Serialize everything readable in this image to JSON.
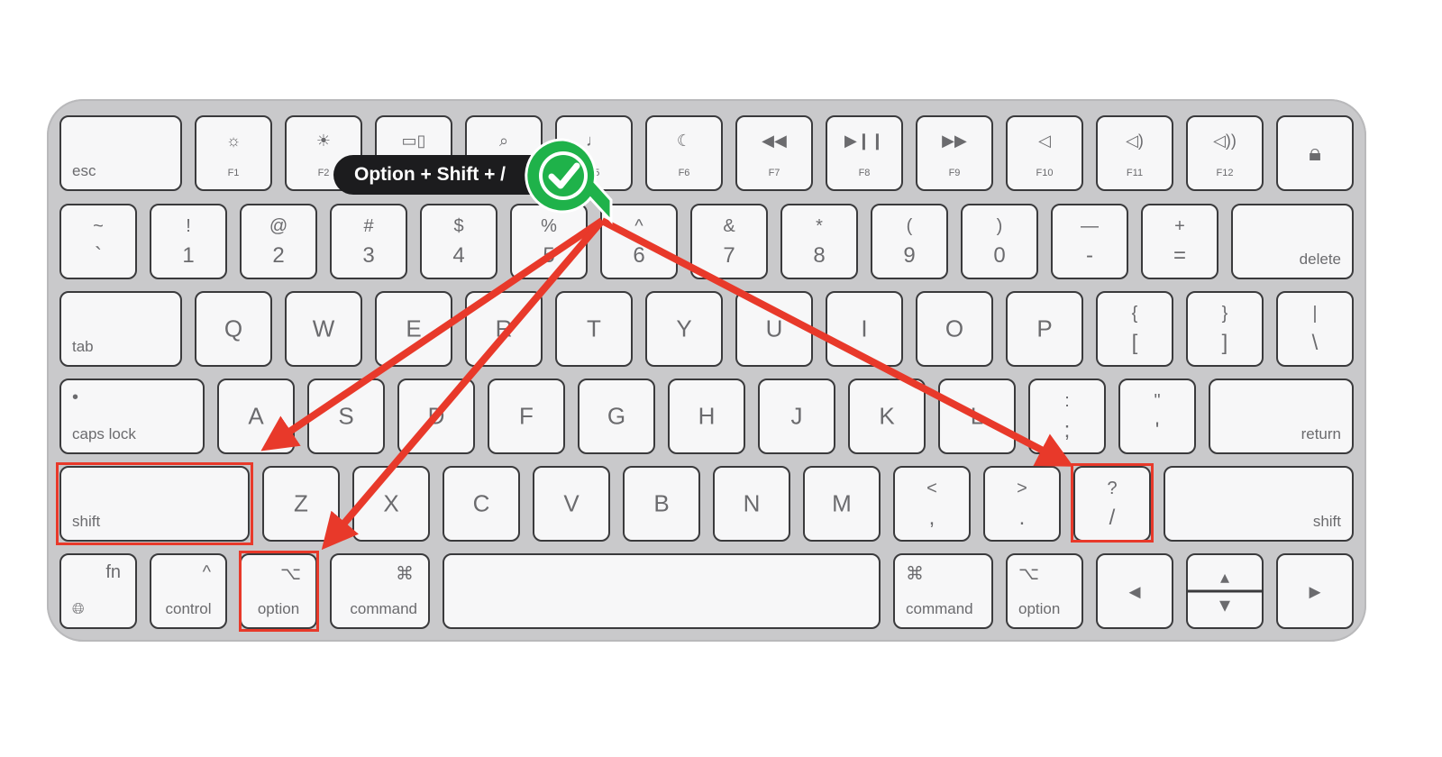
{
  "tooltip": "Option + Shift + /",
  "colors": {
    "arrow": "#e8392a",
    "badge": "#1fb24a",
    "tooltip_bg": "#1c1c1e",
    "key": "#f7f7f8",
    "keyboard": "#c9c9cb"
  },
  "badge_icon": "checkmark-icon",
  "highlighted_keys": [
    "shift",
    "option",
    "/"
  ],
  "rows": [
    [
      {
        "bl": "esc"
      },
      {
        "g": "☼",
        "f": "F1"
      },
      {
        "g": "☀",
        "f": "F2"
      },
      {
        "g": "▭▯",
        "f": "F3"
      },
      {
        "g": "⌕",
        "f": "F4"
      },
      {
        "g": "♩",
        "f": "F5"
      },
      {
        "g": "☾",
        "f": "F6"
      },
      {
        "g": "◀◀",
        "f": "F7"
      },
      {
        "g": "▶❙❙",
        "f": "F8"
      },
      {
        "g": "▶▶",
        "f": "F9"
      },
      {
        "g": "◁",
        "f": "F10"
      },
      {
        "g": "◁)",
        "f": "F11"
      },
      {
        "g": "◁))",
        "f": "F12"
      },
      {
        "c": "🔒︎"
      }
    ],
    [
      {
        "u": "~",
        "l": "`"
      },
      {
        "u": "!",
        "l": "1"
      },
      {
        "u": "@",
        "l": "2"
      },
      {
        "u": "#",
        "l": "3"
      },
      {
        "u": "$",
        "l": "4"
      },
      {
        "u": "%",
        "l": "5"
      },
      {
        "u": "^",
        "l": "6"
      },
      {
        "u": "&",
        "l": "7"
      },
      {
        "u": "*",
        "l": "8"
      },
      {
        "u": "(",
        "l": "9"
      },
      {
        "u": ")",
        "l": "0"
      },
      {
        "u": "—",
        "l": "-"
      },
      {
        "u": "+",
        "l": "="
      },
      {
        "br": "delete"
      }
    ],
    [
      {
        "bl": "tab"
      },
      {
        "c": "Q"
      },
      {
        "c": "W"
      },
      {
        "c": "E"
      },
      {
        "c": "R"
      },
      {
        "c": "T"
      },
      {
        "c": "Y"
      },
      {
        "c": "U"
      },
      {
        "c": "I"
      },
      {
        "c": "O"
      },
      {
        "c": "P"
      },
      {
        "u": "{",
        "l": "["
      },
      {
        "u": "}",
        "l": "]"
      },
      {
        "u": "|",
        "l": "\\"
      }
    ],
    [
      {
        "bl": "caps lock",
        "tl": "•"
      },
      {
        "c": "A"
      },
      {
        "c": "S"
      },
      {
        "c": "D"
      },
      {
        "c": "F"
      },
      {
        "c": "G"
      },
      {
        "c": "H"
      },
      {
        "c": "J"
      },
      {
        "c": "K"
      },
      {
        "c": "L"
      },
      {
        "u": ":",
        "l": ";"
      },
      {
        "u": "\"",
        "l": "'"
      },
      {
        "br": "return"
      }
    ],
    [
      {
        "bl": "shift"
      },
      {
        "c": "Z"
      },
      {
        "c": "X"
      },
      {
        "c": "C"
      },
      {
        "c": "V"
      },
      {
        "c": "B"
      },
      {
        "c": "N"
      },
      {
        "c": "M"
      },
      {
        "u": "<",
        "l": ","
      },
      {
        "u": ">",
        "l": "."
      },
      {
        "u": "?",
        "l": "/"
      },
      {
        "br": "shift"
      }
    ],
    [
      {
        "tr": "fn",
        "bl": "🌐︎"
      },
      {
        "tr": "^",
        "bc": "control"
      },
      {
        "tr": "⌥",
        "bc": "option"
      },
      {
        "tr": "⌘",
        "br": "command"
      },
      {},
      {
        "tl": "⌘",
        "bl": "command"
      },
      {
        "tl": "⌥",
        "bl": "option"
      },
      {
        "c": "◂"
      },
      {
        "u": "▴",
        "l": "▾"
      },
      {
        "c": "▸"
      }
    ]
  ]
}
